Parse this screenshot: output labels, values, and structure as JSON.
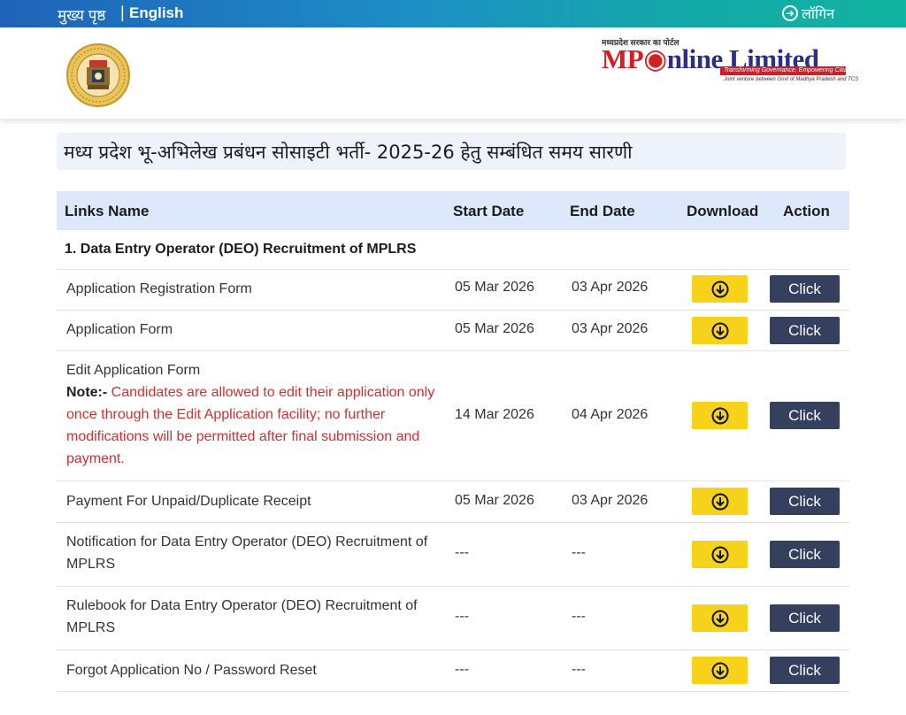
{
  "topbar": {
    "home_label": "मुख्य पृष्ठ",
    "separator": "|",
    "language_label": "English",
    "login_label": "लॉगिन"
  },
  "header": {
    "brand_small": "मध्यप्रदेश सरकार का पोर्टल",
    "brand_name_mp": "MP",
    "brand_name_rest": "nline Limited",
    "brand_tagline": "Transforming Governance, Empowering Citizens",
    "brand_jv": "Joint venture between Govt of Madhya Pradesh and TCS"
  },
  "page_title": "मध्य प्रदेश भू-अभिलेख प्रबंधन सोसाइटी भर्ती- 2025-26 हेतु सम्बंधित समय सारणी",
  "table": {
    "headers": {
      "links_name": "Links Name",
      "start_date": "Start Date",
      "end_date": "End Date",
      "download": "Download",
      "action": "Action"
    },
    "section_title": "1. Data Entry Operator (DEO) Recruitment of MPLRS",
    "rows": [
      {
        "name": "Application Registration Form",
        "start": "05 Mar 2026",
        "end": "03 Apr 2026",
        "action": "Click"
      },
      {
        "name": "Application Form",
        "start": "05 Mar 2026",
        "end": "03 Apr 2026",
        "action": "Click"
      },
      {
        "name": "Edit Application Form",
        "note_label": "Note:-",
        "note_text": " Candidates are allowed to edit their application only once through the Edit Application facility; no further modifications will be permitted after final submission and payment.",
        "start": "14 Mar 2026",
        "end": "04 Apr 2026",
        "action": "Click"
      },
      {
        "name": "Payment For Unpaid/Duplicate Receipt",
        "start": "05 Mar 2026",
        "end": "03 Apr 2026",
        "action": "Click"
      },
      {
        "name": "Notification for Data Entry Operator (DEO) Recruitment of MPLRS",
        "start": "---",
        "end": "---",
        "action": "Click"
      },
      {
        "name": "Rulebook for Data Entry Operator (DEO) Recruitment of MPLRS",
        "start": "---",
        "end": "---",
        "action": "Click"
      },
      {
        "name": "Forgot Application No / Password Reset",
        "start": "---",
        "end": "---",
        "action": "Click"
      }
    ]
  },
  "colors": {
    "download_button": "#f6d21a",
    "action_button": "#34405e",
    "note_text": "#d32f2f",
    "header_row": "#dde8fb"
  }
}
